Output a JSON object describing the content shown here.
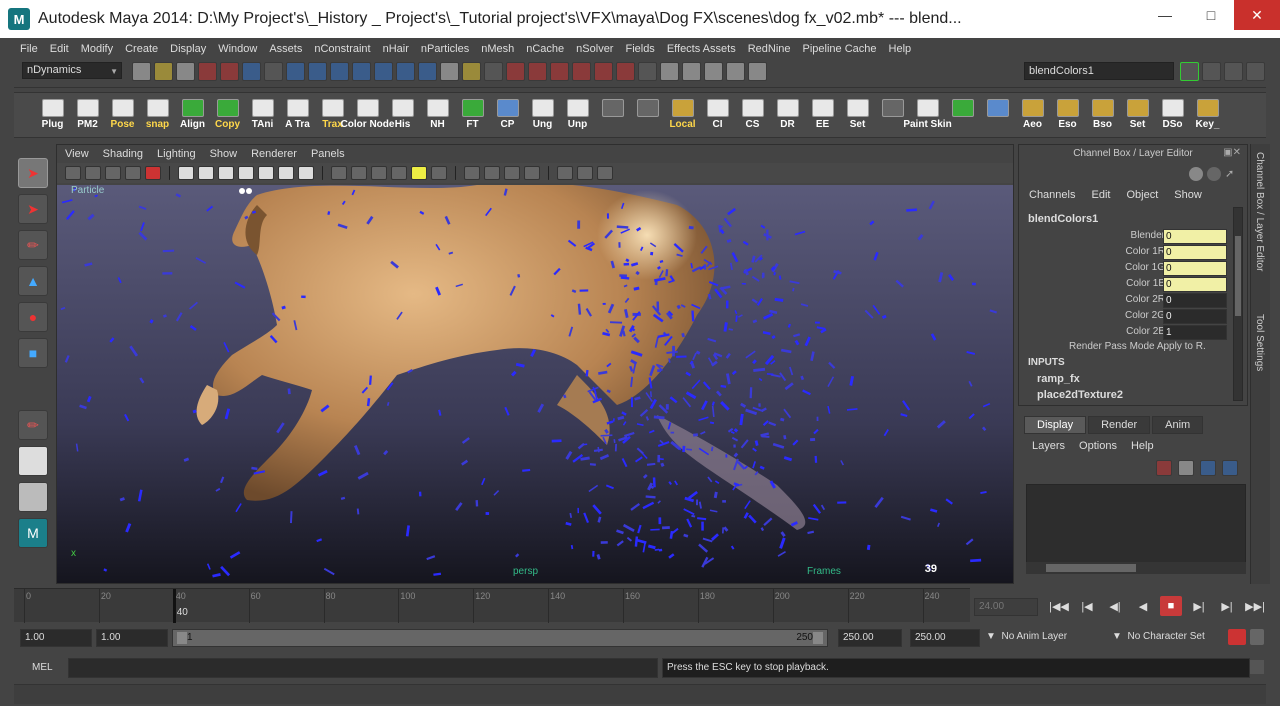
{
  "window": {
    "title": "Autodesk Maya 2014: D:\\My Project's\\_History _ Project's\\_Tutorial project's\\VFX\\maya\\Dog FX\\scenes\\dog fx_v02.mb*  ---  blend...",
    "app_icon": "M"
  },
  "menubar": [
    "File",
    "Edit",
    "Modify",
    "Create",
    "Display",
    "Window",
    "Assets",
    "nConstraint",
    "nHair",
    "nParticles",
    "nMesh",
    "nCache",
    "nSolver",
    "Fields",
    "Effects Assets",
    "RedNine",
    "Pipeline Cache",
    "Help"
  ],
  "statusline": {
    "mode": "nDynamics",
    "object_name": "blendColors1"
  },
  "shelf": [
    {
      "label": "Plug",
      "accent": "#ffffff"
    },
    {
      "label": "PM2",
      "accent": "#ffffff"
    },
    {
      "label": "Pose",
      "accent": "#ffd84a"
    },
    {
      "label": "snap",
      "accent": "#ffd84a"
    },
    {
      "label": "Align",
      "accent": "#ffffff"
    },
    {
      "label": "Copy",
      "accent": "#ffd84a"
    },
    {
      "label": "TAni",
      "accent": "#ffffff"
    },
    {
      "label": "A Tra",
      "accent": "#ffffff"
    },
    {
      "label": "Trax",
      "accent": "#ffd84a"
    },
    {
      "label": "Color Node",
      "accent": "#ffffff"
    },
    {
      "label": "His",
      "accent": "#ffffff"
    },
    {
      "label": "NH",
      "accent": "#ffffff"
    },
    {
      "label": "FT",
      "accent": "#ffffff"
    },
    {
      "label": "CP",
      "accent": "#ffffff"
    },
    {
      "label": "Ung",
      "accent": "#ffffff"
    },
    {
      "label": "Unp",
      "accent": "#ffffff"
    },
    {
      "label": "",
      "accent": "#ffffff"
    },
    {
      "label": "",
      "accent": "#ffffff"
    },
    {
      "label": "Local",
      "accent": "#ffd84a"
    },
    {
      "label": "CI",
      "accent": "#ffffff"
    },
    {
      "label": "CS",
      "accent": "#ffffff"
    },
    {
      "label": "DR",
      "accent": "#ffffff"
    },
    {
      "label": "EE",
      "accent": "#ffffff"
    },
    {
      "label": "Set",
      "accent": "#ffffff"
    },
    {
      "label": "",
      "accent": "#ffffff"
    },
    {
      "label": "Paint Skin",
      "accent": "#ffffff"
    },
    {
      "label": "",
      "accent": "#ffffff"
    },
    {
      "label": "",
      "accent": "#ffffff"
    },
    {
      "label": "Aeo",
      "accent": "#ffffff"
    },
    {
      "label": "Eso",
      "accent": "#ffffff"
    },
    {
      "label": "Bso",
      "accent": "#ffffff"
    },
    {
      "label": "Set",
      "accent": "#ffffff"
    },
    {
      "label": "DSo",
      "accent": "#ffffff"
    },
    {
      "label": "Key_",
      "accent": "#ffffff"
    }
  ],
  "viewport": {
    "menu": [
      "View",
      "Shading",
      "Lighting",
      "Show",
      "Renderer",
      "Panels"
    ],
    "camera_label": "Particle",
    "frame_number": "39",
    "hud_left": "persp",
    "hud_right": "Frames",
    "axis_label": "x"
  },
  "channelbox": {
    "title": "Channel Box / Layer Editor",
    "menu": [
      "Channels",
      "Edit",
      "Object",
      "Show"
    ],
    "node": "blendColors1",
    "attributes": [
      {
        "name": "Blender",
        "value": "0",
        "keyed": true
      },
      {
        "name": "Color 1R",
        "value": "0",
        "keyed": true
      },
      {
        "name": "Color 1G",
        "value": "0",
        "keyed": true
      },
      {
        "name": "Color 1B",
        "value": "0",
        "keyed": true
      },
      {
        "name": "Color 2R",
        "value": "0",
        "keyed": false
      },
      {
        "name": "Color 2G",
        "value": "0",
        "keyed": false
      },
      {
        "name": "Color 2B",
        "value": "1",
        "keyed": false
      }
    ],
    "render_pass_mode": "Render Pass Mode  Apply to R.",
    "inputs_label": "INPUTS",
    "inputs": [
      "ramp_fx",
      "place2dTexture2"
    ]
  },
  "sidetabs": [
    "Channel Box / Layer Editor",
    "Tool Settings"
  ],
  "layer_editor": {
    "tabs": [
      "Display",
      "Render",
      "Anim"
    ],
    "active_tab": "Display",
    "menu": [
      "Layers",
      "Options",
      "Help"
    ]
  },
  "timeslider": {
    "ticks": [
      "0",
      "20",
      "40",
      "60",
      "80",
      "100",
      "120",
      "140",
      "160",
      "180",
      "200",
      "220",
      "240"
    ],
    "current_frame": "40",
    "frame_field": "24.00"
  },
  "range": {
    "start": "1.00",
    "anim_start": "1.00",
    "range_start": "1",
    "range_end": "250",
    "anim_end": "250.00",
    "end": "250.00",
    "anim_layer": "No Anim Layer",
    "character_set": "No Character Set"
  },
  "cmdline": {
    "label": "MEL",
    "result": "Press the ESC key to stop playback."
  }
}
